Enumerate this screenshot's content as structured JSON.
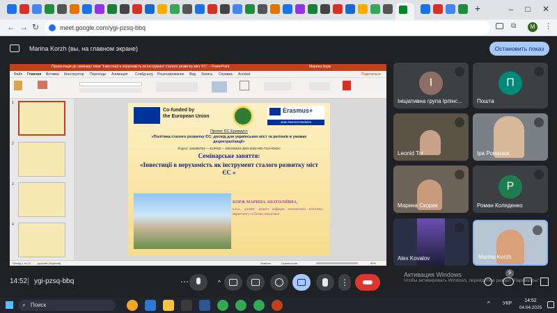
{
  "browser": {
    "url": "meet.google.com/ygi-pzsq-bbq",
    "avatar_letter": "M"
  },
  "presenter": {
    "text": "Marina Korzh (вы, на главном экране)",
    "stop_label": "Остановить показ"
  },
  "ppt": {
    "title_bar": "Презентація до семінару-теми \"Інвестиції в нерухомість як інструмент сталого розвитку міст ЄС\" – PowerPoint",
    "user": "Марина Корж",
    "menu": [
      "Файл",
      "Главная",
      "Вставка",
      "Конструктор",
      "Переходы",
      "Анимация",
      "Слайд-шоу",
      "Рецензирование",
      "Вид",
      "Запись",
      "Справка",
      "Acrobat"
    ],
    "share": "Поделиться",
    "slide_numbers": [
      "1",
      "2",
      "3",
      "4"
    ],
    "status_left": "Слайд 1 из 13",
    "status_lang": "русский (Украина)",
    "status_notes": "Заметки",
    "status_comments": "Примечания",
    "status_zoom": "90%",
    "slide": {
      "cofunded": "Co-funded by\nthe European Union",
      "erasmus": "Erasmus+",
      "jean_monnet": "Jean Monnet Modules",
      "project_label": "Проект ЄС Еразмус+",
      "project_title": "«Політика сталого розвитку ЄС: досвід для українських міст та регіонів в умовах децентралізації»",
      "project_code": "Project: 101085764 — EUPSD — ERASMUS-JMO-2022-HEI-TCH-RSCH",
      "seminar": "Семінарське заняття:",
      "topic": "«Інвестиції в нерухомість як інструмент сталого розвитку міст ЄС »",
      "author": "КОРЖ МАРИНА АНАТОЛІЇВНА,",
      "author_desc": "к.е.н., доцент, доцент кафедри економічної політики, маркетингу та бізнес-аналітики"
    }
  },
  "participants": [
    {
      "name": "Ініціативна група Ірпінс...",
      "initial": "І",
      "color": "#8d6e63"
    },
    {
      "name": "Пошта",
      "initial": "П",
      "color": "#00897b"
    },
    {
      "name": "Leonid Tor",
      "initial": "",
      "color": "#5b5346"
    },
    {
      "name": "Іра Романюк",
      "initial": "",
      "color": "#7b7f86"
    },
    {
      "name": "Марина Скорик",
      "initial": "",
      "color": "#6d6257"
    },
    {
      "name": "Роман Коляденко",
      "initial": "Р",
      "color": "#1e7d4f"
    },
    {
      "name": "Alex Kovalov",
      "initial": "",
      "color": "#2a3147"
    },
    {
      "name": "Marina Korzh",
      "initial": "",
      "color": "#b8c6d4"
    }
  ],
  "meeting": {
    "time": "14:52",
    "code": "ygi-pzsq-bbq",
    "people_badge": "9"
  },
  "watermark": {
    "line1": "Активация Windows",
    "line2": "Чтобы активировать Windows, перейдите в раздел \"Параметры\"."
  },
  "taskbar": {
    "search": "Поиск",
    "lang": "УКР",
    "time": "14:52",
    "date": "04.04.2025"
  }
}
